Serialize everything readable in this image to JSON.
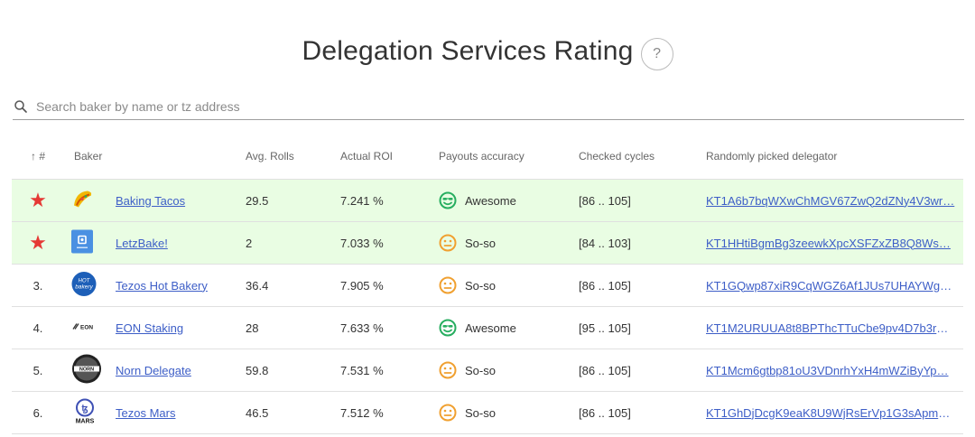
{
  "page": {
    "title": "Delegation Services Rating",
    "help_label": "?"
  },
  "search": {
    "placeholder": "Search baker by name or tz address"
  },
  "colors": {
    "favorite_row_bg": "#e9fde3",
    "star": "#e53935",
    "link": "#3d5ec7",
    "awesome": "#27ae60",
    "so_so": "#f0a030"
  },
  "table": {
    "headers": {
      "sort_arrow": "↑",
      "rank": "#",
      "baker": "Baker",
      "rolls": "Avg. Rolls",
      "roi": "Actual ROI",
      "accuracy": "Payouts accuracy",
      "cycles": "Checked cycles",
      "delegator": "Randomly picked delegator"
    },
    "rows": [
      {
        "rank": "",
        "favorite": true,
        "logo": "taco-logo",
        "name": "Baking Tacos",
        "rolls": "29.5",
        "roi": "7.241 %",
        "accuracy": "Awesome",
        "accuracy_icon": "smile-glasses-icon",
        "cycles": "[86 .. 105]",
        "delegator": "KT1A6b7bqWXwChMGV67ZwQ2dZNy4V3wr…"
      },
      {
        "rank": "",
        "favorite": true,
        "logo": "letzbake-logo",
        "name": "LetzBake!",
        "rolls": "2",
        "roi": "7.033 %",
        "accuracy": "So-so",
        "accuracy_icon": "neutral-face-icon",
        "cycles": "[84 .. 103]",
        "delegator": "KT1HHtiBgmBg3zeewkXpcXSFZxZB8Q8Ws…"
      },
      {
        "rank": "3.",
        "favorite": false,
        "logo": "hot-bakery-logo",
        "logo_text": "HOT bakery",
        "name": "Tezos Hot Bakery",
        "rolls": "36.4",
        "roi": "7.905 %",
        "accuracy": "So-so",
        "accuracy_icon": "neutral-face-icon",
        "cycles": "[86 .. 105]",
        "delegator": "KT1GQwp87xiR9CqWGZ6Af1JUs7UHAYWge…"
      },
      {
        "rank": "4.",
        "favorite": false,
        "logo": "eon-logo",
        "logo_text": "EON",
        "name": "EON Staking",
        "rolls": "28",
        "roi": "7.633 %",
        "accuracy": "Awesome",
        "accuracy_icon": "smile-glasses-icon",
        "cycles": "[95 .. 105]",
        "delegator": "KT1M2URUUA8t8BPThcTTuCbe9pv4D7b3rR…"
      },
      {
        "rank": "5.",
        "favorite": false,
        "logo": "norn-logo",
        "logo_text": "NORN",
        "name": "Norn Delegate",
        "rolls": "59.8",
        "roi": "7.531 %",
        "accuracy": "So-so",
        "accuracy_icon": "neutral-face-icon",
        "cycles": "[86 .. 105]",
        "delegator": "KT1Mcm6gtbp81oU3VDnrhYxH4mWZiByYp…"
      },
      {
        "rank": "6.",
        "favorite": false,
        "logo": "tezos-mars-logo",
        "logo_text": "MARS",
        "name": "Tezos Mars",
        "rolls": "46.5",
        "roi": "7.512 %",
        "accuracy": "So-so",
        "accuracy_icon": "neutral-face-icon",
        "cycles": "[86 .. 105]",
        "delegator": "KT1GhDjDcgK9eaK8U9WjRsErVp1G3sApm8…"
      }
    ]
  }
}
